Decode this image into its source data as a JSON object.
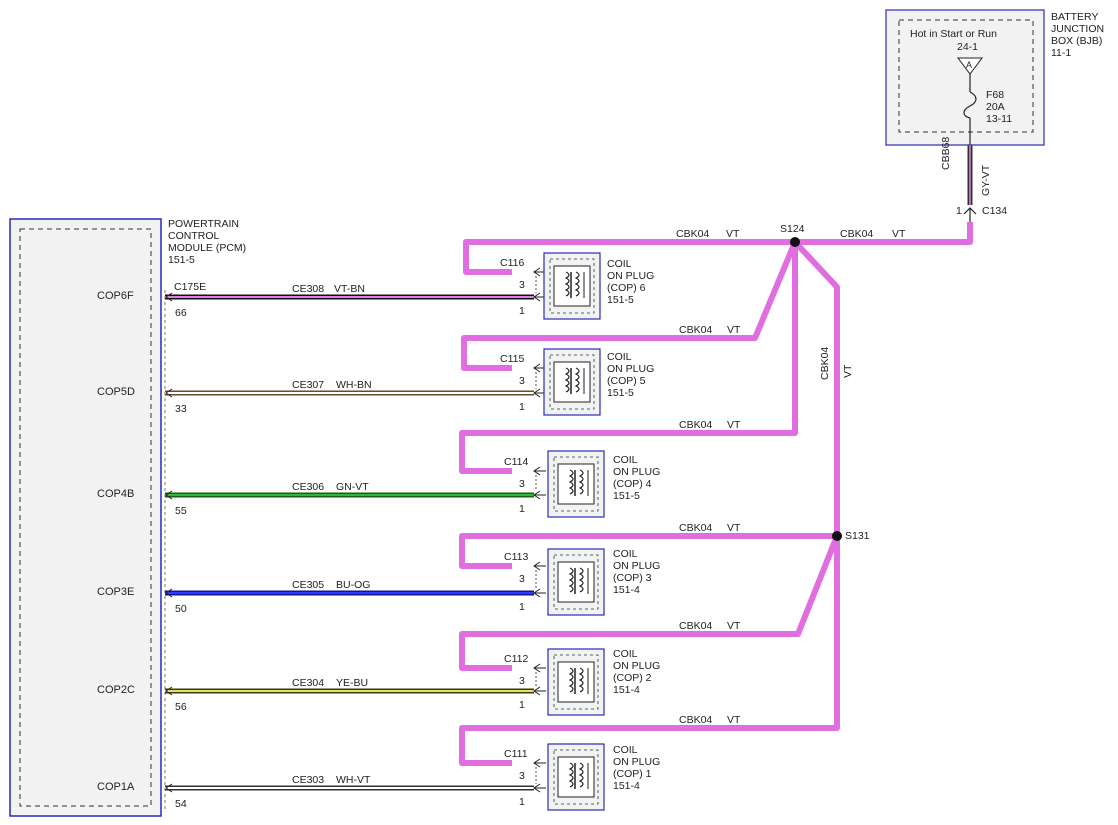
{
  "bjb": {
    "title": "BATTERY\nJUNCTION\nBOX (BJB)\n11-1",
    "hot_label": "Hot in Start or Run",
    "hot_ref": "24-1",
    "triangle_label": "A",
    "fuse_name": "F68",
    "fuse_rating": "20A",
    "fuse_ref": "13-11"
  },
  "feed": {
    "circuit": "CBB68",
    "color": "GY-VT",
    "pin": "1",
    "connector": "C134"
  },
  "pcm": {
    "title": "POWERTRAIN\nCONTROL\nMODULE (PCM)\n151-5",
    "connector": "C175E"
  },
  "splices": {
    "s1": "S124",
    "s2": "S131"
  },
  "vert_feed": {
    "circuit": "CBK04",
    "color": "VT"
  },
  "feed_labels": {
    "top_circuit": "CBK04",
    "top_color": "VT",
    "right_circuit": "CBK04",
    "right_color": "VT"
  },
  "coils": [
    {
      "pcm_pin_name": "COP6F",
      "pcm_pin": "66",
      "circuit": "CE308",
      "color": "VT-BN",
      "wire_hex": "#111111",
      "wire_stripe": "#e879e8",
      "connector": "C116",
      "coil_label": "COIL\nON PLUG\n(COP) 6\n151-5",
      "feed_circuit": "CBK04",
      "feed_color": "VT",
      "pin3": "3",
      "pin1": "1"
    },
    {
      "pcm_pin_name": "COP5D",
      "pcm_pin": "33",
      "circuit": "CE307",
      "color": "WH-BN",
      "wire_hex": "#6b4a2a",
      "wire_stripe": "#ffffff",
      "connector": "C115",
      "coil_label": "COIL\nON PLUG\n(COP) 5\n151-5",
      "feed_circuit": "CBK04",
      "feed_color": "VT",
      "pin3": "3",
      "pin1": "1"
    },
    {
      "pcm_pin_name": "COP4B",
      "pcm_pin": "55",
      "circuit": "CE306",
      "color": "GN-VT",
      "wire_hex": "#1a5e1a",
      "wire_stripe": "#2db82d",
      "connector": "C114",
      "coil_label": "COIL\nON PLUG\n(COP) 4\n151-5",
      "feed_circuit": "CBK04",
      "feed_color": "VT",
      "pin3": "3",
      "pin1": "1"
    },
    {
      "pcm_pin_name": "COP3E",
      "pcm_pin": "50",
      "circuit": "CE305",
      "color": "BU-OG",
      "wire_hex": "#111199",
      "wire_stripe": "#2a3cff",
      "connector": "C113",
      "coil_label": "COIL\nON PLUG\n(COP) 3\n151-4",
      "feed_circuit": "CBK04",
      "feed_color": "VT",
      "pin3": "3",
      "pin1": "1"
    },
    {
      "pcm_pin_name": "COP2C",
      "pcm_pin": "56",
      "circuit": "CE304",
      "color": "YE-BU",
      "wire_hex": "#3a3a10",
      "wire_stripe": "#e6e060",
      "connector": "C112",
      "coil_label": "COIL\nON PLUG\n(COP) 2\n151-4",
      "feed_circuit": "CBK04",
      "feed_color": "VT",
      "pin3": "3",
      "pin1": "1"
    },
    {
      "pcm_pin_name": "COP1A",
      "pcm_pin": "54",
      "circuit": "CE303",
      "color": "WH-VT",
      "wire_hex": "#333333",
      "wire_stripe": "#ffffff",
      "connector": "C111",
      "coil_label": "COIL\nON PLUG\n(COP) 1\n151-4",
      "feed_circuit": "CBK04",
      "feed_color": "VT",
      "pin3": "3",
      "pin1": "1"
    }
  ],
  "colors": {
    "violet_wire": "#e06ee0",
    "module_border": "#2a2ab8",
    "module_fill": "#f2f2f2"
  }
}
